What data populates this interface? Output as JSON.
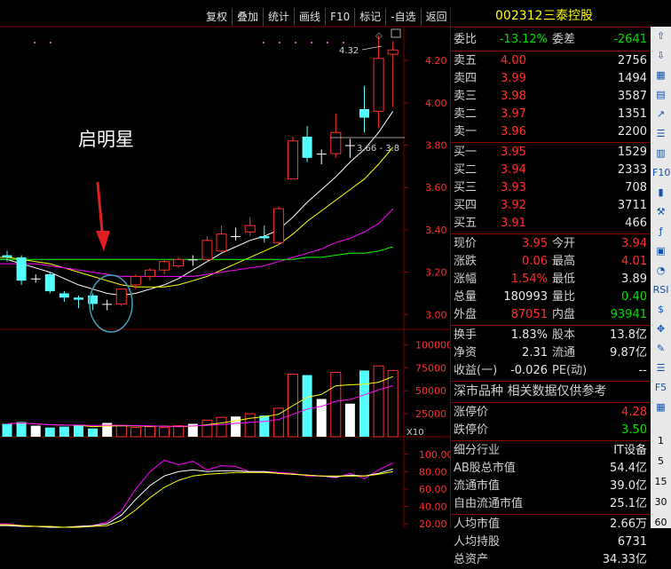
{
  "toolbar": [
    "复权",
    "叠加",
    "统计",
    "画线",
    "F10",
    "标记",
    "-自选",
    "返回"
  ],
  "stock": {
    "code": "002312",
    "name": "三泰控股"
  },
  "annotation": {
    "text": "启明星",
    "high_label": "4.32",
    "range_label": "3.66 - 3.8"
  },
  "price_axis": [
    "4.20",
    "4.00",
    "3.80",
    "3.60",
    "3.40",
    "3.20",
    "3.00"
  ],
  "volume_axis": [
    "100000",
    "75000",
    "50000",
    "25000"
  ],
  "volume_unit": "X10",
  "indicator_axis": [
    "100.00",
    "80.00",
    "60.00",
    "40.00",
    "20.00"
  ],
  "quote": {
    "webi": {
      "label": "委比",
      "value": "-13.12%",
      "label2": "委差",
      "value2": "-2641"
    },
    "asks": [
      {
        "label": "卖五",
        "price": "4.00",
        "vol": "2756"
      },
      {
        "label": "卖四",
        "price": "3.99",
        "vol": "1494"
      },
      {
        "label": "卖三",
        "price": "3.98",
        "vol": "3587"
      },
      {
        "label": "卖二",
        "price": "3.97",
        "vol": "1351"
      },
      {
        "label": "卖一",
        "price": "3.96",
        "vol": "2200"
      }
    ],
    "bids": [
      {
        "label": "买一",
        "price": "3.95",
        "vol": "1529"
      },
      {
        "label": "买二",
        "price": "3.94",
        "vol": "2333"
      },
      {
        "label": "买三",
        "price": "3.93",
        "vol": "708"
      },
      {
        "label": "买四",
        "price": "3.92",
        "vol": "3711"
      },
      {
        "label": "买五",
        "price": "3.91",
        "vol": "466"
      }
    ],
    "stats": [
      {
        "l1": "现价",
        "v1": "3.95",
        "c1": "red",
        "l2": "今开",
        "v2": "3.94",
        "c2": "red"
      },
      {
        "l1": "涨跌",
        "v1": "0.06",
        "c1": "red",
        "l2": "最高",
        "v2": "4.01",
        "c2": "red"
      },
      {
        "l1": "涨幅",
        "v1": "1.54%",
        "c1": "red",
        "l2": "最低",
        "v2": "3.89",
        "c2": "white"
      },
      {
        "l1": "总量",
        "v1": "180993",
        "c1": "white",
        "l2": "量比",
        "v2": "0.40",
        "c2": "green"
      },
      {
        "l1": "外盘",
        "v1": "87051",
        "c1": "red",
        "l2": "内盘",
        "v2": "93941",
        "c2": "green"
      }
    ],
    "stats2": [
      {
        "l1": "换手",
        "v1": "1.83%",
        "l2": "股本",
        "v2": "13.8亿"
      },
      {
        "l1": "净资",
        "v1": "2.31",
        "l2": "流通",
        "v2": "9.87亿"
      },
      {
        "l1": "收益(一)",
        "v1": "-0.026",
        "l2": "PE(动)",
        "v2": "--"
      }
    ],
    "section_title": "深市品种  相关数据仅供参考",
    "limits": [
      {
        "label": "涨停价",
        "value": "4.28",
        "color": "red"
      },
      {
        "label": "跌停价",
        "value": "3.50",
        "color": "green"
      }
    ],
    "info": [
      {
        "label": "细分行业",
        "value": "IT设备"
      },
      {
        "label": "AB股总市值",
        "value": "54.4亿"
      },
      {
        "label": "流通市值",
        "value": "39.0亿"
      },
      {
        "label": "自由流通市值",
        "value": "25.1亿"
      },
      {
        "label": "人均市值",
        "value": "2.66万"
      },
      {
        "label": "人均持股",
        "value": "6731"
      },
      {
        "label": "总资产",
        "value": "34.33亿"
      }
    ]
  },
  "side_numbers": [
    "1",
    "5",
    "15",
    "30",
    "60"
  ],
  "chart_data": {
    "type": "candlestick",
    "price_ylim": [
      2.93,
      4.36
    ],
    "candles": [
      {
        "o": 3.28,
        "c": 3.27,
        "h": 3.3,
        "l": 3.25
      },
      {
        "o": 3.27,
        "c": 3.16,
        "h": 3.28,
        "l": 3.14
      },
      {
        "o": 3.17,
        "c": 3.17,
        "h": 3.19,
        "l": 3.15
      },
      {
        "o": 3.19,
        "c": 3.11,
        "h": 3.2,
        "l": 3.1
      },
      {
        "o": 3.1,
        "c": 3.08,
        "h": 3.11,
        "l": 3.06
      },
      {
        "o": 3.08,
        "c": 3.07,
        "h": 3.09,
        "l": 3.03
      },
      {
        "o": 3.09,
        "c": 3.05,
        "h": 3.1,
        "l": 3.02
      },
      {
        "o": 3.05,
        "c": 3.05,
        "h": 3.07,
        "l": 3.02
      },
      {
        "o": 3.05,
        "c": 3.12,
        "h": 3.12,
        "l": 3.04
      },
      {
        "o": 3.14,
        "c": 3.18,
        "h": 3.19,
        "l": 3.12
      },
      {
        "o": 3.18,
        "c": 3.21,
        "h": 3.22,
        "l": 3.16
      },
      {
        "o": 3.21,
        "c": 3.25,
        "h": 3.26,
        "l": 3.19
      },
      {
        "o": 3.23,
        "c": 3.26,
        "h": 3.27,
        "l": 3.22
      },
      {
        "o": 3.26,
        "c": 3.26,
        "h": 3.28,
        "l": 3.23
      },
      {
        "o": 3.26,
        "c": 3.35,
        "h": 3.37,
        "l": 3.25
      },
      {
        "o": 3.3,
        "c": 3.38,
        "h": 3.42,
        "l": 3.29
      },
      {
        "o": 3.37,
        "c": 3.37,
        "h": 3.41,
        "l": 3.35
      },
      {
        "o": 3.39,
        "c": 3.42,
        "h": 3.46,
        "l": 3.37
      },
      {
        "o": 3.37,
        "c": 3.36,
        "h": 3.42,
        "l": 3.34
      },
      {
        "o": 3.34,
        "c": 3.5,
        "h": 3.51,
        "l": 3.33
      },
      {
        "o": 3.64,
        "c": 3.82,
        "h": 3.84,
        "l": 3.64
      },
      {
        "o": 3.84,
        "c": 3.74,
        "h": 3.89,
        "l": 3.72
      },
      {
        "o": 3.76,
        "c": 3.76,
        "h": 3.78,
        "l": 3.71
      },
      {
        "o": 3.76,
        "c": 3.86,
        "h": 3.95,
        "l": 3.74
      },
      {
        "o": 3.8,
        "c": 3.8,
        "h": 3.83,
        "l": 3.74
      },
      {
        "o": 3.97,
        "c": 3.93,
        "h": 4.08,
        "l": 3.86
      },
      {
        "o": 3.96,
        "c": 4.21,
        "h": 4.32,
        "l": 3.88
      },
      {
        "o": 4.23,
        "c": 4.25,
        "h": 4.29,
        "l": 3.98
      }
    ],
    "ma_series": [
      {
        "color": "#ffffff",
        "values": [
          3.26,
          3.24,
          3.22,
          3.2,
          3.17,
          3.14,
          3.12,
          3.1,
          3.09,
          3.1,
          3.12,
          3.14,
          3.17,
          3.21,
          3.25,
          3.29,
          3.32,
          3.35,
          3.37,
          3.4,
          3.46,
          3.53,
          3.59,
          3.65,
          3.72,
          3.78,
          3.86,
          3.96
        ]
      },
      {
        "color": "#ffff00",
        "values": [
          3.27,
          3.26,
          3.25,
          3.24,
          3.22,
          3.2,
          3.18,
          3.16,
          3.14,
          3.13,
          3.13,
          3.13,
          3.14,
          3.16,
          3.18,
          3.21,
          3.24,
          3.27,
          3.3,
          3.33,
          3.38,
          3.44,
          3.49,
          3.54,
          3.59,
          3.64,
          3.71,
          3.79
        ]
      },
      {
        "color": "#ff00ff",
        "values": [
          3.24,
          3.24,
          3.24,
          3.23,
          3.22,
          3.21,
          3.2,
          3.19,
          3.18,
          3.18,
          3.18,
          3.18,
          3.18,
          3.18,
          3.19,
          3.2,
          3.21,
          3.22,
          3.23,
          3.25,
          3.27,
          3.29,
          3.31,
          3.34,
          3.36,
          3.39,
          3.43,
          3.5
        ]
      },
      {
        "color": "#00ff00",
        "values": [
          3.26,
          3.26,
          3.26,
          3.26,
          3.26,
          3.26,
          3.26,
          3.26,
          3.26,
          3.26,
          3.26,
          3.26,
          3.26,
          3.26,
          3.26,
          3.26,
          3.26,
          3.26,
          3.26,
          3.26,
          3.26,
          3.27,
          3.27,
          3.28,
          3.29,
          3.29,
          3.3,
          3.32
        ]
      }
    ],
    "volume_ylim": [
      0,
      110000
    ],
    "volume": [
      14000,
      16000,
      12000,
      10000,
      11000,
      13000,
      9000,
      15000,
      12000,
      10000,
      11000,
      10000,
      12000,
      14000,
      18000,
      21000,
      22000,
      25000,
      23000,
      31000,
      68000,
      67000,
      41000,
      70000,
      36000,
      72000,
      77000,
      72000
    ],
    "indicator_ylim": [
      15,
      112
    ],
    "indicator_series": [
      {
        "color": "#ff00ff",
        "values": [
          20,
          18,
          17,
          16,
          16,
          17,
          18,
          22,
          35,
          60,
          80,
          93,
          88,
          92,
          82,
          87,
          86,
          80,
          80,
          79,
          78,
          75,
          75,
          73,
          78,
          72,
          82,
          90
        ]
      },
      {
        "color": "#ffffff",
        "values": [
          18,
          17,
          17,
          16,
          16,
          17,
          18,
          20,
          30,
          48,
          64,
          75,
          80,
          82,
          80,
          81,
          81,
          80,
          80,
          78,
          77,
          76,
          75,
          74,
          76,
          75,
          78,
          83
        ]
      },
      {
        "color": "#ffff00",
        "values": [
          19,
          18,
          17,
          17,
          16,
          16,
          17,
          18,
          24,
          36,
          50,
          62,
          70,
          75,
          77,
          78,
          79,
          79,
          79,
          78,
          77,
          76,
          75,
          75,
          75,
          75,
          77,
          80
        ]
      }
    ]
  }
}
